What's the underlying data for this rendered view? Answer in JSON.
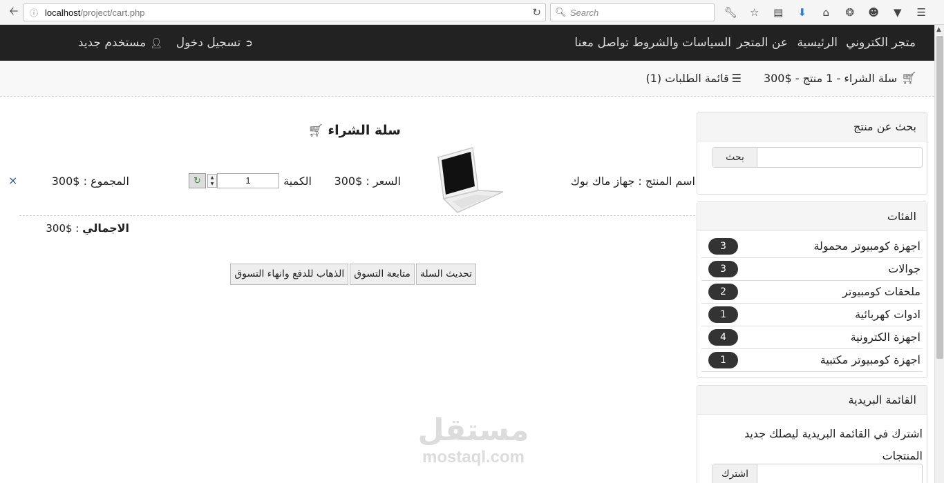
{
  "browser": {
    "url_host": "localhost",
    "url_path": "/project/cart.php",
    "search_placeholder": "Search",
    "icons": [
      "wrench-icon",
      "star-icon",
      "reader-icon",
      "download-icon",
      "home-icon",
      "sync-icon",
      "smiley-icon",
      "pocket-icon",
      "menu-icon"
    ]
  },
  "nav": {
    "brand": "متجر الكتروني",
    "links": [
      "الرئيسية",
      "عن المتجر",
      "السياسات والشروط",
      "تواصل معنا"
    ],
    "login": "تسجيل دخول",
    "register": "مستخدم جديد"
  },
  "cartbar": {
    "summary": "سلة الشراء - 1 منتج - $300",
    "orders": "قائمة الطلبات (1)"
  },
  "sidebar": {
    "search_title": "بحث عن منتج",
    "search_button": "بحث",
    "categories_title": "الفئات",
    "categories": [
      {
        "label": "اجهزة كومبيوتر محمولة",
        "count": "3"
      },
      {
        "label": "جوالات",
        "count": "3"
      },
      {
        "label": "ملحقات كومبيوتر",
        "count": "2"
      },
      {
        "label": "ادوات كهربائية",
        "count": "1"
      },
      {
        "label": "اجهزة الكترونية",
        "count": "4"
      },
      {
        "label": "اجهزة كومبيوتر مكتبية",
        "count": "1"
      }
    ],
    "newsletter_title": "القائمة البريدية",
    "newsletter_text": "اشترك في القائمة البريدية ليصلك جديد المنتجات",
    "subscribe_button": "اشترك"
  },
  "cart": {
    "title": "سلة الشراء",
    "item": {
      "name": "اسم المنتج : جهاز ماك بوك",
      "price": "السعر : $300",
      "qty_label": "الكمية :",
      "qty": "1",
      "subtotal": "المجموع : $300",
      "remove": "×"
    },
    "total_label": "الاجمالي",
    "total_value": " : $300",
    "buttons": {
      "update": "تحديث السلة",
      "continue": "متابعة التسوق",
      "checkout": "الذهاب للدفع وانهاء التسوق"
    }
  },
  "watermark": {
    "arabic": "مستقل",
    "latin": "mostaql.com"
  }
}
